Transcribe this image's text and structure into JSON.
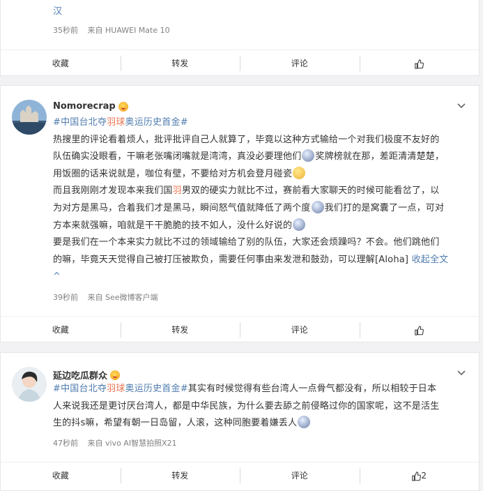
{
  "card1": {
    "text_tail": "汉",
    "time": "35秒前",
    "source": "来自 HUAWEI Mate 10",
    "actions": {
      "favorite": "收藏",
      "repost": "转发",
      "comment": "评论",
      "like_count": ""
    }
  },
  "card2": {
    "username": "Nomorecrap",
    "hashtag": "#中国台北夺羽球奥运历史首金#",
    "hashtag_parts": [
      "#中国台北夺",
      "羽球",
      "奥运历史首金#"
    ],
    "lines": [
      "热搜里的评论看着烦人，批评批评自己人就算了，毕竟以这种方式输给一个对我们极度不友好的",
      "队伍确实没眼看，干嘛老张嘴闭嘴就是湾湾，真没必要理他们",
      "奖牌榜就在那，差距清清楚楚，",
      "用饭圈的话来说就是，咖位有壁，不要给对方机会登月碰瓷",
      "而且我刚刚才发现本来我们国",
      "羽",
      "男双的硬实力就比不过，赛前看大家聊天的时候可能看岔了，以",
      "为对方是黑马，合着我们才是黑马，瞬间怒气值就降低了两个度",
      "我们打的是窝囊了一点，可对",
      "方本来就强嘛，咱就是干干脆脆的技不如人，没什么好说的",
      "要是我们在一个本来实力就比不过的领域输给了别的队伍，大家还会烦躁吗？不会。他们跳他们",
      "的嘛，毕竟天天觉得自己被打压被欺负，需要任何事由来发泄和鼓劲，可以理解[Aloha]",
      "收起全文"
    ],
    "collapse_arrow": "^",
    "time": "39秒前",
    "source": "来自 See微博客户端",
    "actions": {
      "favorite": "收藏",
      "repost": "转发",
      "comment": "评论",
      "like_count": ""
    }
  },
  "card3": {
    "username": "延边吃瓜群众",
    "hashtag_parts": [
      "#中国台北夺",
      "羽球",
      "奥运历史首金#"
    ],
    "lines": [
      "其实有时候觉得有些台湾人一点骨气都没有，所以相较于日本",
      "人来说我还是更讨厌台湾人，都是中华民族，为什么要去舔之前侵略过你的国家呢，这不是活生",
      "生的抖s嘛，希望有朝一日岛留，人滚，这种同胞要着嫌丢人"
    ],
    "time": "47秒前",
    "source": "来自 vivo AI智慧拍照X21",
    "actions": {
      "favorite": "收藏",
      "repost": "转发",
      "comment": "评论",
      "like_count": "2"
    }
  },
  "colors": {
    "link": "#eb7350",
    "hashtag": "#507daf",
    "meta": "#808080",
    "background": "#f2f2f5"
  },
  "icons": {
    "dropdown": "chevron-down-icon",
    "like": "thumbs-up-icon",
    "vip": "vip-badge-icon"
  }
}
